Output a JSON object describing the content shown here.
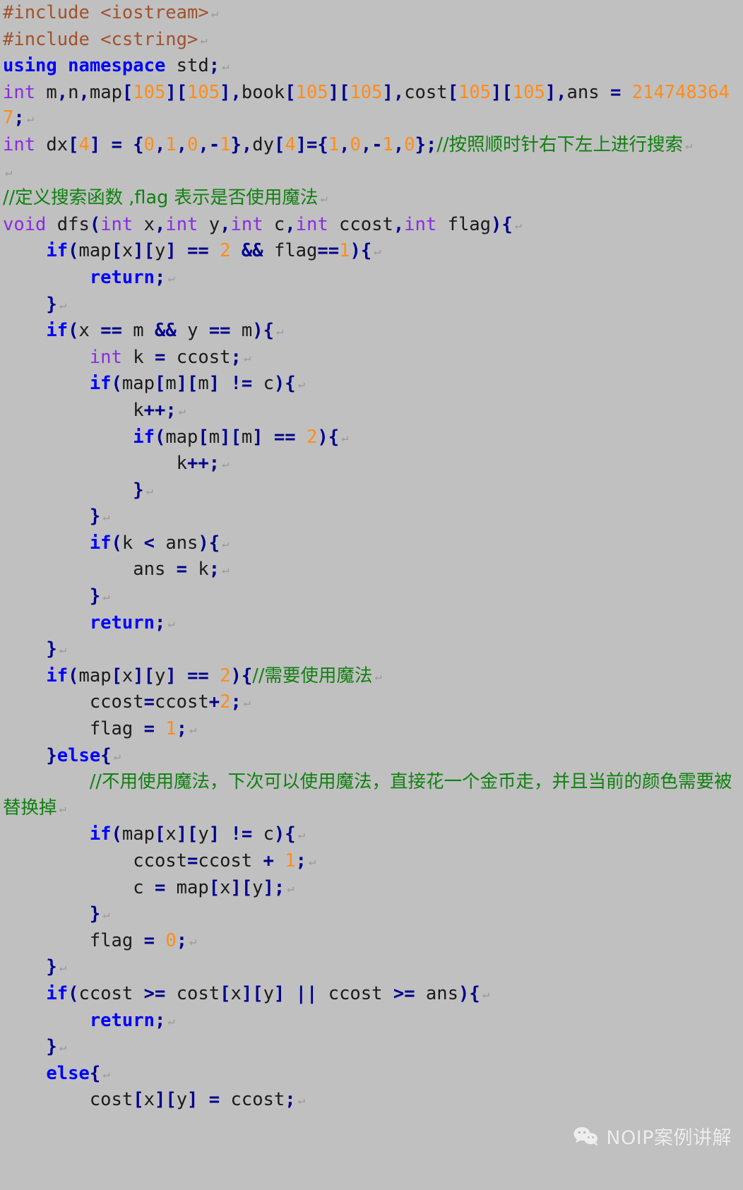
{
  "document": {
    "kind": "source-code-screenshot",
    "language": "C++",
    "background_color": "#c0c0c0",
    "line_end_marker": "↵"
  },
  "theme": {
    "preprocessor_color": "#a0522d",
    "keyword_color": "#0000ff",
    "type_color": "#8a2be2",
    "number_color": "#ff8c1a",
    "punctuation_color": "#00008b",
    "operator_color": "#00008b",
    "comment_color": "#108010",
    "plain_color": "#1a1a1a"
  },
  "watermark": {
    "text": "NOIP案例讲解",
    "icon": "wechat-icon",
    "icon_color": "#f2f2f2"
  },
  "code": {
    "lines": [
      {
        "id": "l1",
        "text": "#include <iostream>"
      },
      {
        "id": "l2",
        "text": "#include <cstring>"
      },
      {
        "id": "l3",
        "text": "using namespace std;"
      },
      {
        "id": "l4",
        "text": "int m,n,map[105][105],book[105][105],cost[105][105],ans = 2147483647;"
      },
      {
        "id": "l5",
        "text": "int dx[4] = {0,1,0,-1},dy[4]={1,0,-1,0};//按照顺时针右下左上进行搜索"
      },
      {
        "id": "l6",
        "text": ""
      },
      {
        "id": "l7",
        "text": "//定义搜索函数 ,flag 表示是否使用魔法"
      },
      {
        "id": "l8",
        "text": "void dfs(int x,int y,int c,int ccost,int flag){"
      },
      {
        "id": "l9",
        "text": "    if(map[x][y] == 2 && flag==1){"
      },
      {
        "id": "l10",
        "text": "        return;"
      },
      {
        "id": "l11",
        "text": "    }"
      },
      {
        "id": "l12",
        "text": "    if(x == m && y == m){"
      },
      {
        "id": "l13",
        "text": "        int k = ccost;"
      },
      {
        "id": "l14",
        "text": "        if(map[m][m] != c){"
      },
      {
        "id": "l15",
        "text": "            k++;"
      },
      {
        "id": "l16",
        "text": "            if(map[m][m] == 2){"
      },
      {
        "id": "l17",
        "text": "                k++;"
      },
      {
        "id": "l18",
        "text": "            }"
      },
      {
        "id": "l19",
        "text": "        }"
      },
      {
        "id": "l20",
        "text": "        if(k < ans){"
      },
      {
        "id": "l21",
        "text": "            ans = k;"
      },
      {
        "id": "l22",
        "text": "        }"
      },
      {
        "id": "l23",
        "text": "        return;"
      },
      {
        "id": "l24",
        "text": "    }"
      },
      {
        "id": "l25",
        "text": "    if(map[x][y] == 2){//需要使用魔法"
      },
      {
        "id": "l26",
        "text": "        ccost=ccost+2;"
      },
      {
        "id": "l27",
        "text": "        flag = 1;"
      },
      {
        "id": "l28",
        "text": "    }else{"
      },
      {
        "id": "l29",
        "text": "        //不用使用魔法，下次可以使用魔法，直接花一个金币走，并且当前的颜色需要被替换掉"
      },
      {
        "id": "l30",
        "text": "        if(map[x][y] != c){"
      },
      {
        "id": "l31",
        "text": "            ccost=ccost + 1;"
      },
      {
        "id": "l32",
        "text": "            c = map[x][y];"
      },
      {
        "id": "l33",
        "text": "        }"
      },
      {
        "id": "l34",
        "text": "        flag = 0;"
      },
      {
        "id": "l35",
        "text": "    }"
      },
      {
        "id": "l36",
        "text": "    if(ccost >= cost[x][y] || ccost >= ans){"
      },
      {
        "id": "l37",
        "text": "        return;"
      },
      {
        "id": "l38",
        "text": "    }"
      },
      {
        "id": "l39",
        "text": "    else{"
      },
      {
        "id": "l40",
        "text": "        cost[x][y] = ccost;"
      }
    ]
  }
}
